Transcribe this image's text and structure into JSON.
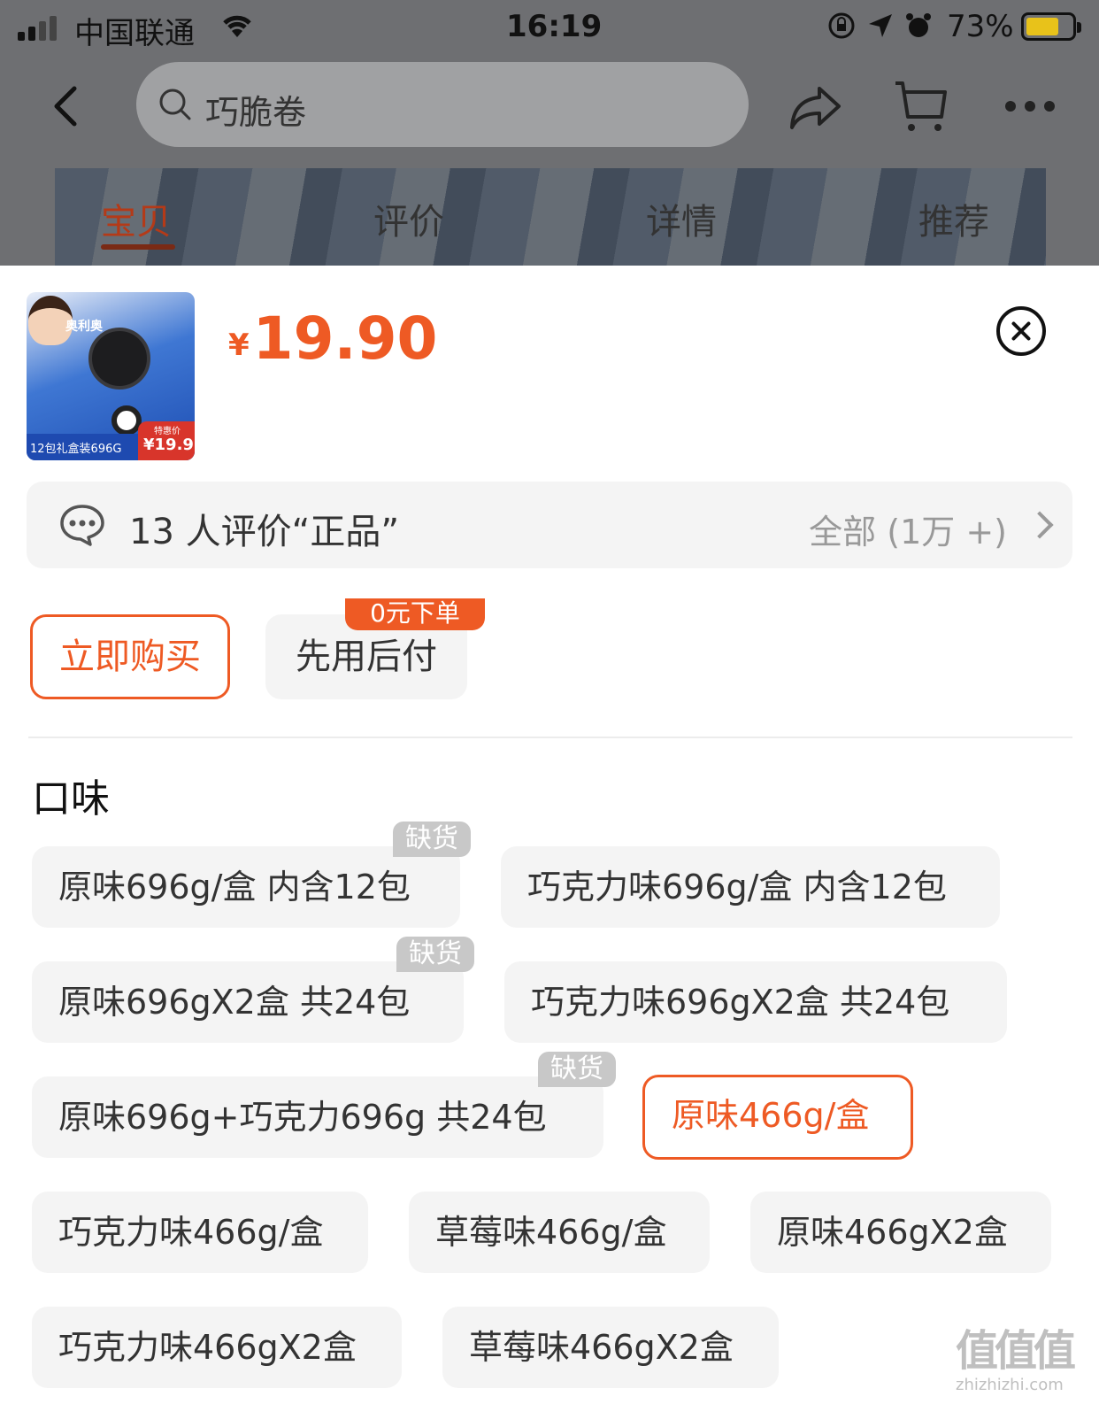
{
  "status_bar": {
    "carrier": "中国联通",
    "time": "16:19",
    "battery_percent": "73%",
    "battery_level": 0.73,
    "icons": [
      "signal-icon",
      "wifi-icon",
      "rotation-lock-icon",
      "location-icon",
      "alarm-icon",
      "battery-charging-icon"
    ]
  },
  "nav": {
    "search_text": "巧脆卷",
    "icons": [
      "back-icon",
      "search-icon",
      "share-icon",
      "cart-icon",
      "more-icon"
    ]
  },
  "tabs": [
    "宝贝",
    "评价",
    "详情",
    "推荐"
  ],
  "product": {
    "currency": "¥",
    "price": "19.90",
    "thumbnail_text": {
      "brand": "奥利奥",
      "caption": "12包礼盒装696G",
      "tag_label": "特惠价",
      "tag_price": "¥19.9"
    }
  },
  "review": {
    "summary": "13 人评价“正品”",
    "all_label": "全部 (1万 +)"
  },
  "purchase_modes": {
    "buy_now": "立即购买",
    "pay_later": "先用后付",
    "pay_later_badge": "0元下单"
  },
  "flavor": {
    "title": "口味",
    "out_of_stock_label": "缺货",
    "accent_color": "#ee5a24",
    "options": [
      {
        "label": "原味696g/盒 内含12包",
        "out_of_stock": true,
        "selected": false
      },
      {
        "label": "巧克力味696g/盒 内含12包",
        "out_of_stock": false,
        "selected": false
      },
      {
        "label": "原味696gX2盒 共24包",
        "out_of_stock": true,
        "selected": false
      },
      {
        "label": "巧克力味696gX2盒 共24包",
        "out_of_stock": false,
        "selected": false
      },
      {
        "label": "原味696g+巧克力696g 共24包",
        "out_of_stock": true,
        "selected": false
      },
      {
        "label": "原味466g/盒",
        "out_of_stock": false,
        "selected": true
      },
      {
        "label": "巧克力味466g/盒",
        "out_of_stock": false,
        "selected": false
      },
      {
        "label": "草莓味466g/盒",
        "out_of_stock": false,
        "selected": false
      },
      {
        "label": "原味466gX2盒",
        "out_of_stock": false,
        "selected": false
      },
      {
        "label": "巧克力味466gX2盒",
        "out_of_stock": false,
        "selected": false
      },
      {
        "label": "草莓味466gX2盒",
        "out_of_stock": false,
        "selected": false
      }
    ]
  },
  "watermark": {
    "logo": "值值值",
    "domain": "zhizhizhi.com"
  }
}
